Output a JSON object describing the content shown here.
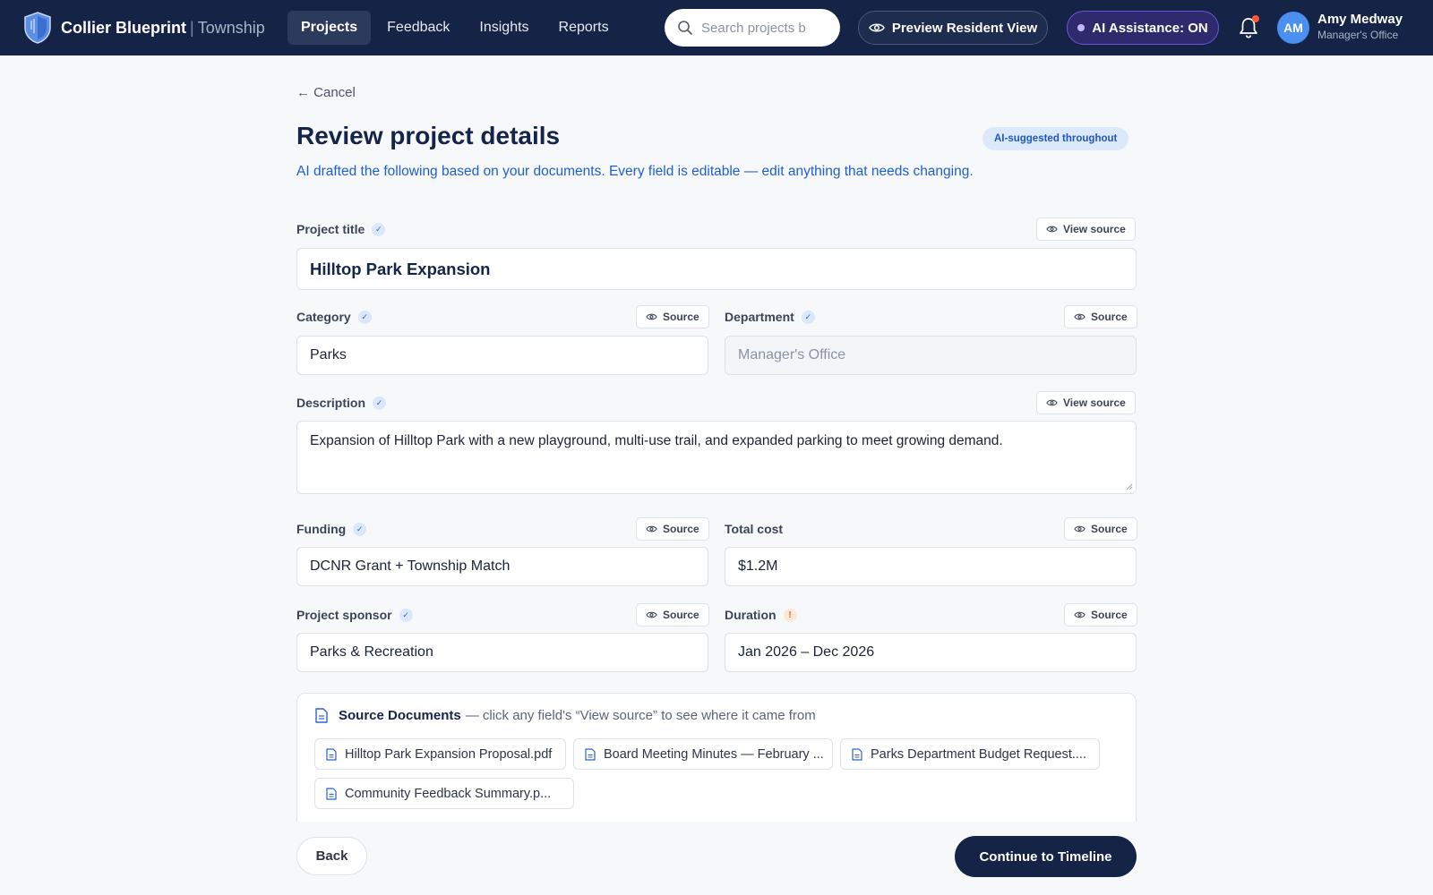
{
  "app": {
    "brand_name": "Collier Blueprint",
    "brand_separator": "|",
    "brand_sub": "Township"
  },
  "nav": {
    "items": [
      {
        "label": "Projects",
        "active": true
      },
      {
        "label": "Feedback",
        "active": false
      },
      {
        "label": "Insights",
        "active": false
      },
      {
        "label": "Reports",
        "active": false
      }
    ]
  },
  "search": {
    "placeholder": "Search projects b"
  },
  "header_actions": {
    "preview_label": "Preview Resident View",
    "ai_label": "AI Assistance: ON"
  },
  "user": {
    "initials": "AM",
    "name": "Amy Medway",
    "role": "Manager's Office"
  },
  "page": {
    "cancel_label": "← Cancel",
    "title": "Review project details",
    "ai_badge": "AI-suggested throughout",
    "subtitle": "AI drafted the following based on your documents. Every field is editable — edit anything that needs changing."
  },
  "form": {
    "project_title": {
      "label": "Project title",
      "value": "Hilltop Park Expansion",
      "source_label": "View source"
    },
    "category": {
      "label": "Category",
      "value": "Parks",
      "source_label": "Source"
    },
    "department": {
      "label": "Department",
      "placeholder": "Manager's Office",
      "source_label": "Source"
    },
    "description": {
      "label": "Description",
      "value": "Expansion of Hilltop Park with a new playground, multi-use trail, and expanded parking to meet growing demand.",
      "source_label": "View source"
    },
    "funding": {
      "label": "Funding",
      "value": "DCNR Grant + Township Match",
      "source_label": "Source"
    },
    "total_cost": {
      "label": "Total cost",
      "value": "$1.2M",
      "source_label": "Source"
    },
    "project_sponsor": {
      "label": "Project sponsor",
      "value": "Parks & Recreation",
      "source_label": "Source"
    },
    "duration": {
      "label": "Duration",
      "value": "Jan 2026 – Dec 2026",
      "source_label": "Source",
      "warning": "!"
    }
  },
  "source_documents": {
    "title": "Source Documents",
    "hint": "— click any field's “View source” to see where it came from",
    "docs": [
      "Hilltop Park Expansion Proposal.pdf",
      "Board Meeting Minutes — February ...",
      "Parks Department Budget Request....",
      "Community Feedback Summary.p..."
    ]
  },
  "footer": {
    "back_label": "Back",
    "continue_label": "Continue to Timeline"
  },
  "colors": {
    "nav_bg": "#152446",
    "accent_blue": "#1f5fd4",
    "ai_purple": "#2f2a6e",
    "warning_orange": "#e06a1f",
    "notification_dot": "#ff5a36"
  }
}
